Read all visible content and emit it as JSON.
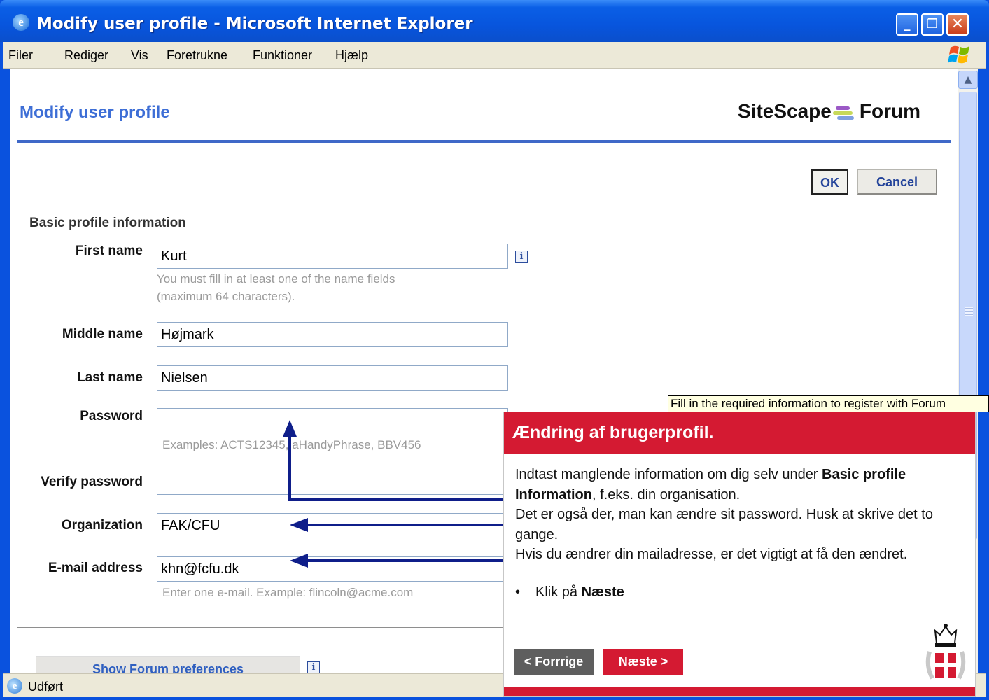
{
  "window": {
    "title": "Modify user profile - Microsoft Internet Explorer",
    "min_symbol": "_",
    "max_symbol": "❐",
    "close_symbol": "✕"
  },
  "menu": [
    "Filer",
    "Rediger",
    "Vis",
    "Foretrukne",
    "Funktioner",
    "Hjælp"
  ],
  "page": {
    "title": "Modify user profile",
    "brand_left": "SiteScape",
    "brand_right": "Forum",
    "ok_label": "OK",
    "cancel_label": "Cancel"
  },
  "form": {
    "legend": "Basic profile information",
    "first_name": {
      "label": "First name",
      "value": "Kurt",
      "hint1": "You must fill in at least one of the name fields",
      "hint2": "(maximum 64 characters)."
    },
    "middle_name": {
      "label": "Middle name",
      "value": "Højmark"
    },
    "last_name": {
      "label": "Last name",
      "value": "Nielsen"
    },
    "password": {
      "label": "Password",
      "value": "",
      "hint": "Examples: ACTS12345, aHandyPhrase, BBV456"
    },
    "verify_password": {
      "label": "Verify password",
      "value": ""
    },
    "organization": {
      "label": "Organization",
      "value": "FAK/CFU"
    },
    "email": {
      "label": "E-mail address",
      "value": "khn@fcfu.dk",
      "hint": "Enter one e-mail. Example: flincoln@acme.com"
    },
    "prefs_button": "Show Forum preferences",
    "info_symbol": "i"
  },
  "tooltip": "Fill in the required information to register with Forum",
  "help": {
    "title": "Ændring af brugerprofil.",
    "p1_start": "Indtast manglende information om dig selv under ",
    "p1_bold": "Basic profile Information",
    "p1_end": ", f.eks. din organisation.",
    "p2": "Det er også der, man kan ændre sit password. Husk at skrive det to gange.",
    "p3": "Hvis du ændrer din mailadresse, er det vigtigt at få den ændret.",
    "bullet_start": "Klik på ",
    "bullet_bold": "Næste",
    "prev_label": "< Forrrige",
    "next_label": "Næste >"
  },
  "status": {
    "text": "Udført"
  },
  "colors": {
    "accent": "#3d6ed6",
    "help_red": "#d41a32",
    "arrow": "#0f1e8a"
  }
}
